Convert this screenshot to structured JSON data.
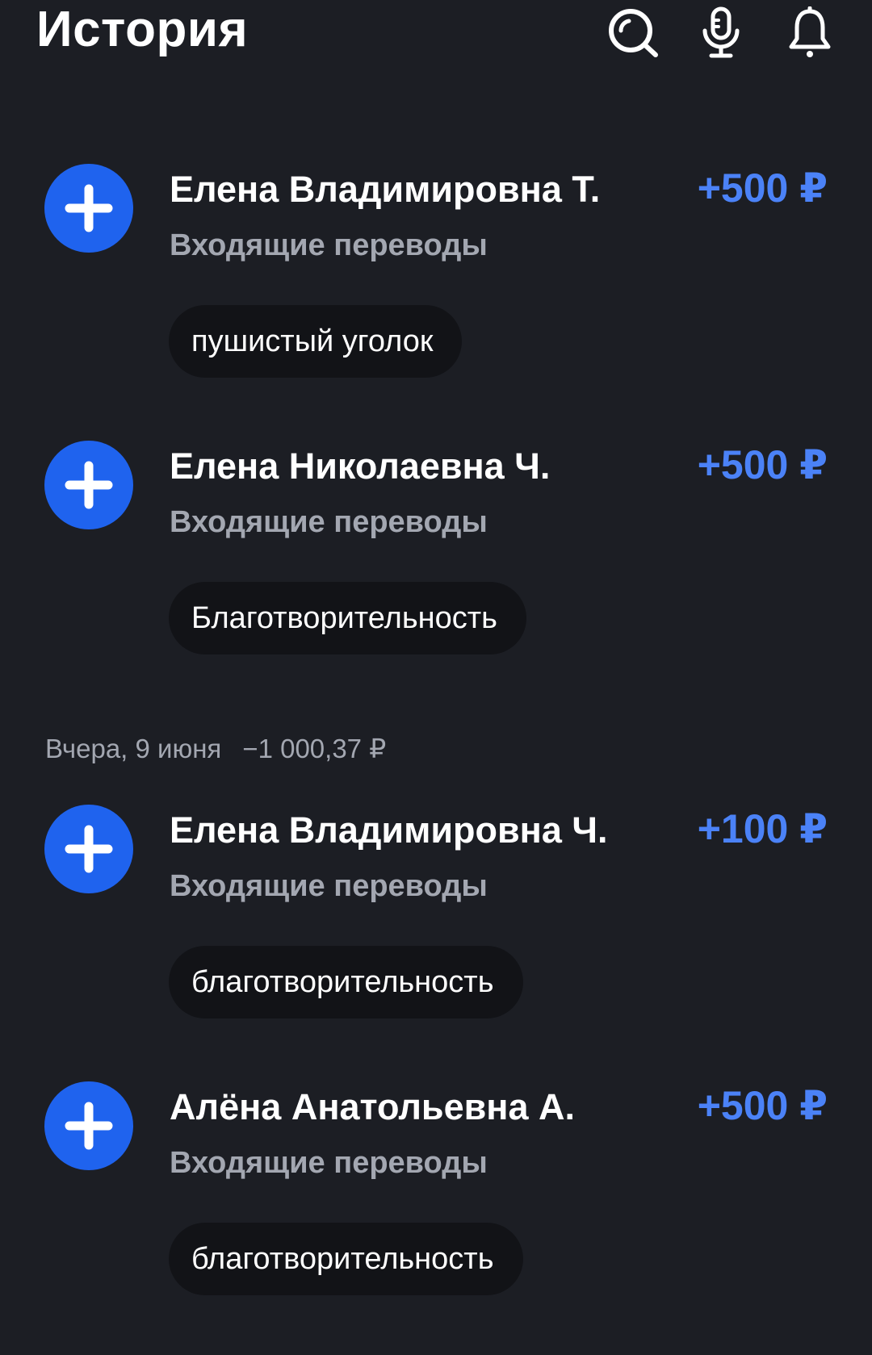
{
  "header": {
    "title": "История",
    "icons": [
      "search-icon",
      "microphone-icon",
      "bell-icon"
    ]
  },
  "colors": {
    "background": "#1c1e24",
    "accent": "#1f63ee",
    "amount": "#4b82f7",
    "secondary_text": "#a3a7b1",
    "chip_background": "#121317"
  },
  "transactions": [
    {
      "name": "Елена Владимировна Т.",
      "amount": "+500 ₽",
      "category": "Входящие переводы",
      "comment": "пушистый уголок",
      "icon": "plus-icon"
    },
    {
      "name": "Елена Николаевна Ч.",
      "amount": "+500 ₽",
      "category": "Входящие переводы",
      "comment": "Благотворительность",
      "icon": "plus-icon"
    },
    {
      "name": "Елена Владимировна Ч.",
      "amount": "+100 ₽",
      "category": "Входящие переводы",
      "comment": "благотворительность",
      "icon": "plus-icon"
    },
    {
      "name": "Алёна Анатольевна А.",
      "amount": "+500 ₽",
      "category": "Входящие переводы",
      "comment": "благотворительность",
      "icon": "plus-icon"
    }
  ],
  "date_group": {
    "label": "Вчера, 9 июня",
    "total": "−1 000,37 ₽"
  }
}
